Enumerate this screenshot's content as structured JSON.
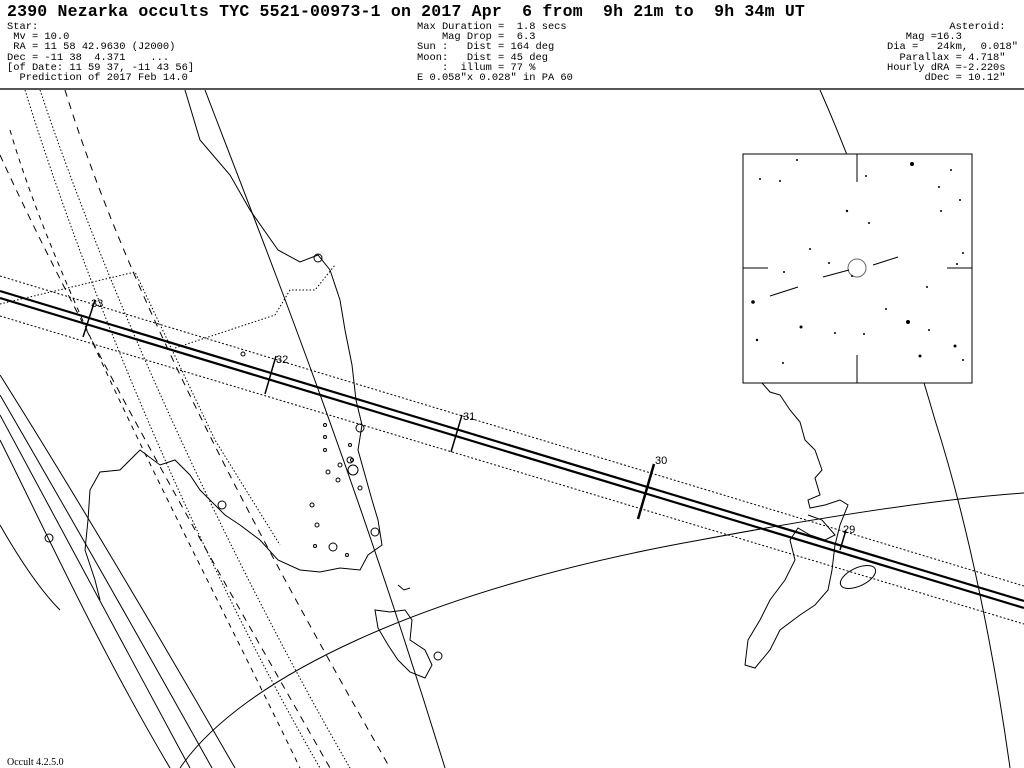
{
  "title": "2390 Nezarka occults TYC 5521-00973-1 on 2017 Apr  6 from  9h 21m to  9h 34m UT",
  "star": {
    "heading": "Star:",
    "mv": " Mv = 10.0",
    "ra": " RA = 11 58 42.9630 (J2000)",
    "dec": "Dec = -11 38  4.371    ...",
    "of_date": "[of Date: 11 59 37, -11 43 56]",
    "prediction": "  Prediction of 2017 Feb 14.0"
  },
  "event": {
    "max_duration": "Max Duration =  1.8 secs",
    "mag_drop": "    Mag Drop =  6.3",
    "sun": "Sun :   Dist = 164 deg",
    "moon": "Moon:   Dist = 45 deg",
    "illum": "    :  illum = 77 %",
    "ellipse": "E 0.058\"x 0.028\" in PA 60"
  },
  "asteroid": {
    "heading": "Asteroid:  ",
    "mag": "Mag =16.3         ",
    "dia": "Dia =   24km,  0.018\"",
    "parallax": "Parallax = 4.718\"  ",
    "hourly_dra": "Hourly dRA =-2.220s  ",
    "ddec": "dDec = 10.12\"  "
  },
  "time_ticks": [
    "33",
    "32",
    "31",
    "30",
    "29"
  ],
  "version": "Occult 4.2.5.0"
}
